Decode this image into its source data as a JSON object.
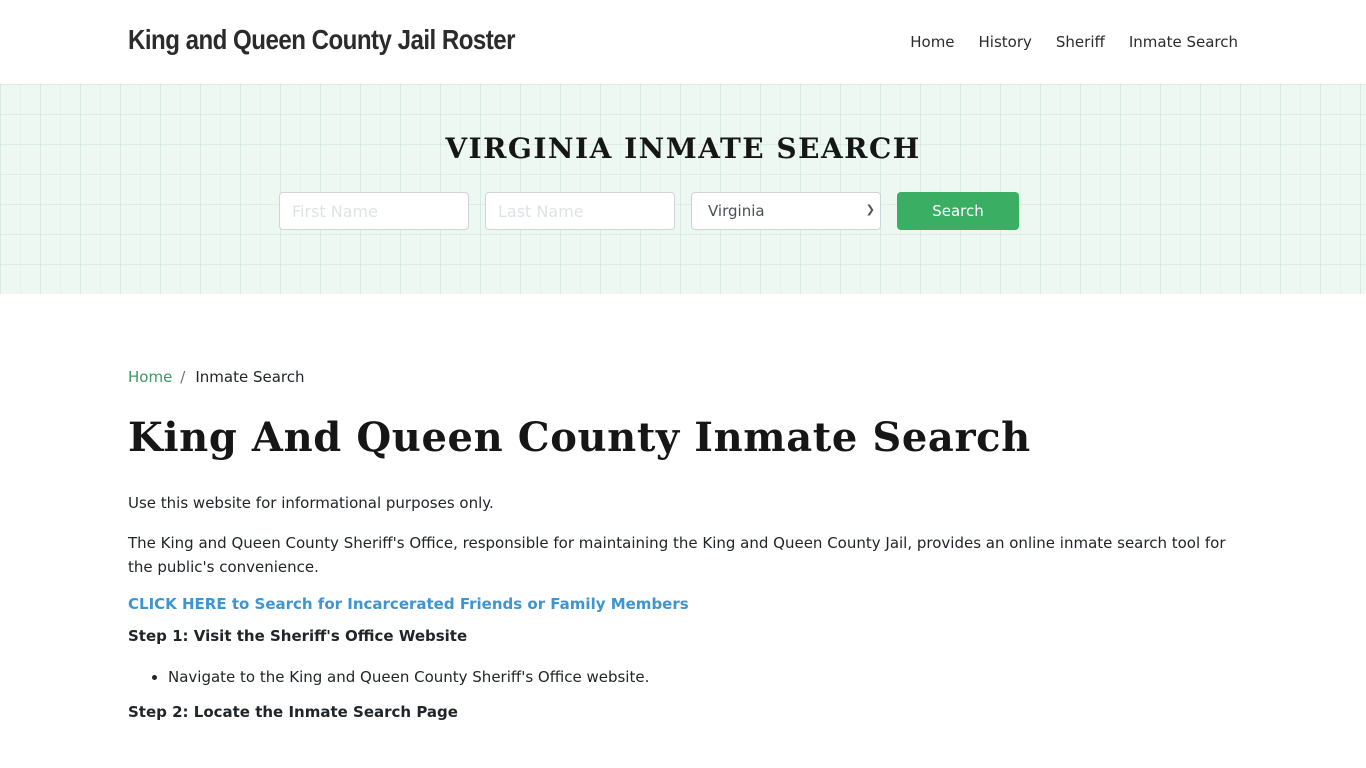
{
  "header": {
    "brand": "King and Queen County Jail Roster",
    "nav": [
      "Home",
      "History",
      "Sheriff",
      "Inmate Search"
    ]
  },
  "hero": {
    "title": "VIRGINIA INMATE SEARCH",
    "first_name_placeholder": "First Name",
    "last_name_placeholder": "Last Name",
    "first_name_value": "",
    "last_name_value": "",
    "state_selected": "Virginia",
    "search_label": "Search"
  },
  "breadcrumb": {
    "home": "Home",
    "separator": "/",
    "current": "Inmate Search"
  },
  "main": {
    "title": "King And Queen County Inmate Search",
    "intro": "Use this website for informational purposes only.",
    "paragraph": "The King and Queen County Sheriff's Office, responsible for maintaining the King and Queen County Jail, provides an online inmate search tool for the public's convenience.",
    "cta_link": "CLICK HERE to Search for Incarcerated Friends or Family Members",
    "steps": [
      {
        "title": "Step 1: Visit the Sheriff's Office Website",
        "bullets": [
          "Navigate to the King and Queen County Sheriff's Office website."
        ]
      },
      {
        "title": "Step 2: Locate the Inmate Search Page"
      }
    ]
  },
  "colors": {
    "accent_green": "#3aae62",
    "link_blue": "#3d95d1",
    "breadcrumb_green": "#3a9b63",
    "hero_background": "#edf8f2"
  }
}
